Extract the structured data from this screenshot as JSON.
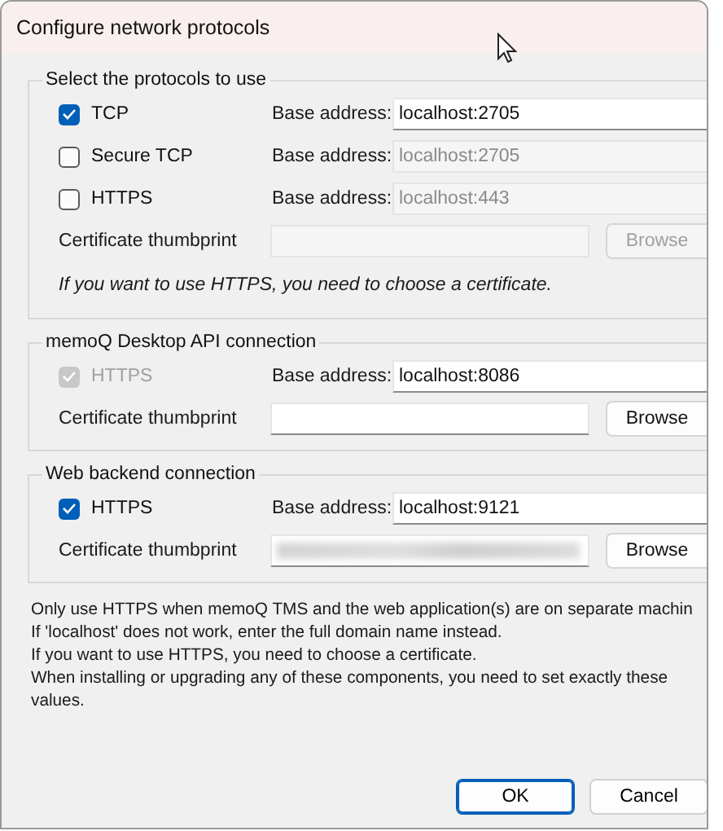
{
  "window": {
    "title": "Configure network protocols"
  },
  "groups": [
    {
      "title": "Select the protocols to use",
      "protocols": [
        {
          "label": "TCP",
          "checked": true,
          "disabled": false,
          "address_label": "Base address:",
          "address": "localhost:2705",
          "address_enabled": true
        },
        {
          "label": "Secure TCP",
          "checked": false,
          "disabled": false,
          "address_label": "Base address:",
          "address": "localhost:2705",
          "address_enabled": false
        },
        {
          "label": "HTTPS",
          "checked": false,
          "disabled": false,
          "address_label": "Base address:",
          "address": "localhost:443",
          "address_enabled": false
        }
      ],
      "certificate": {
        "label": "Certificate thumbprint",
        "enabled": false,
        "redacted": false,
        "button": "Browse"
      },
      "note": "If you want to use HTTPS, you need to choose a certificate."
    },
    {
      "title": "memoQ Desktop API connection",
      "protocols": [
        {
          "label": "HTTPS",
          "checked": true,
          "disabled": true,
          "address_label": "Base address:",
          "address": "localhost:8086",
          "address_enabled": true
        }
      ],
      "certificate": {
        "label": "Certificate thumbprint",
        "enabled": true,
        "redacted": false,
        "button": "Browse"
      }
    },
    {
      "title": "Web backend connection",
      "protocols": [
        {
          "label": "HTTPS",
          "checked": true,
          "disabled": false,
          "address_label": "Base address:",
          "address": "localhost:9121",
          "address_enabled": true
        }
      ],
      "certificate": {
        "label": "Certificate thumbprint",
        "enabled": true,
        "redacted": true,
        "button": "Browse"
      }
    }
  ],
  "notes": [
    "Only use HTTPS when memoQ TMS and the web application(s) are on separate machin",
    "If 'localhost' does not work, enter the full domain name instead.",
    "If you want to use HTTPS, you need to choose a certificate.",
    "When installing or upgrading any of these components, you need to set exactly these values."
  ],
  "buttons": [
    {
      "label": "OK",
      "default": true
    },
    {
      "label": "Cancel",
      "default": false
    }
  ]
}
